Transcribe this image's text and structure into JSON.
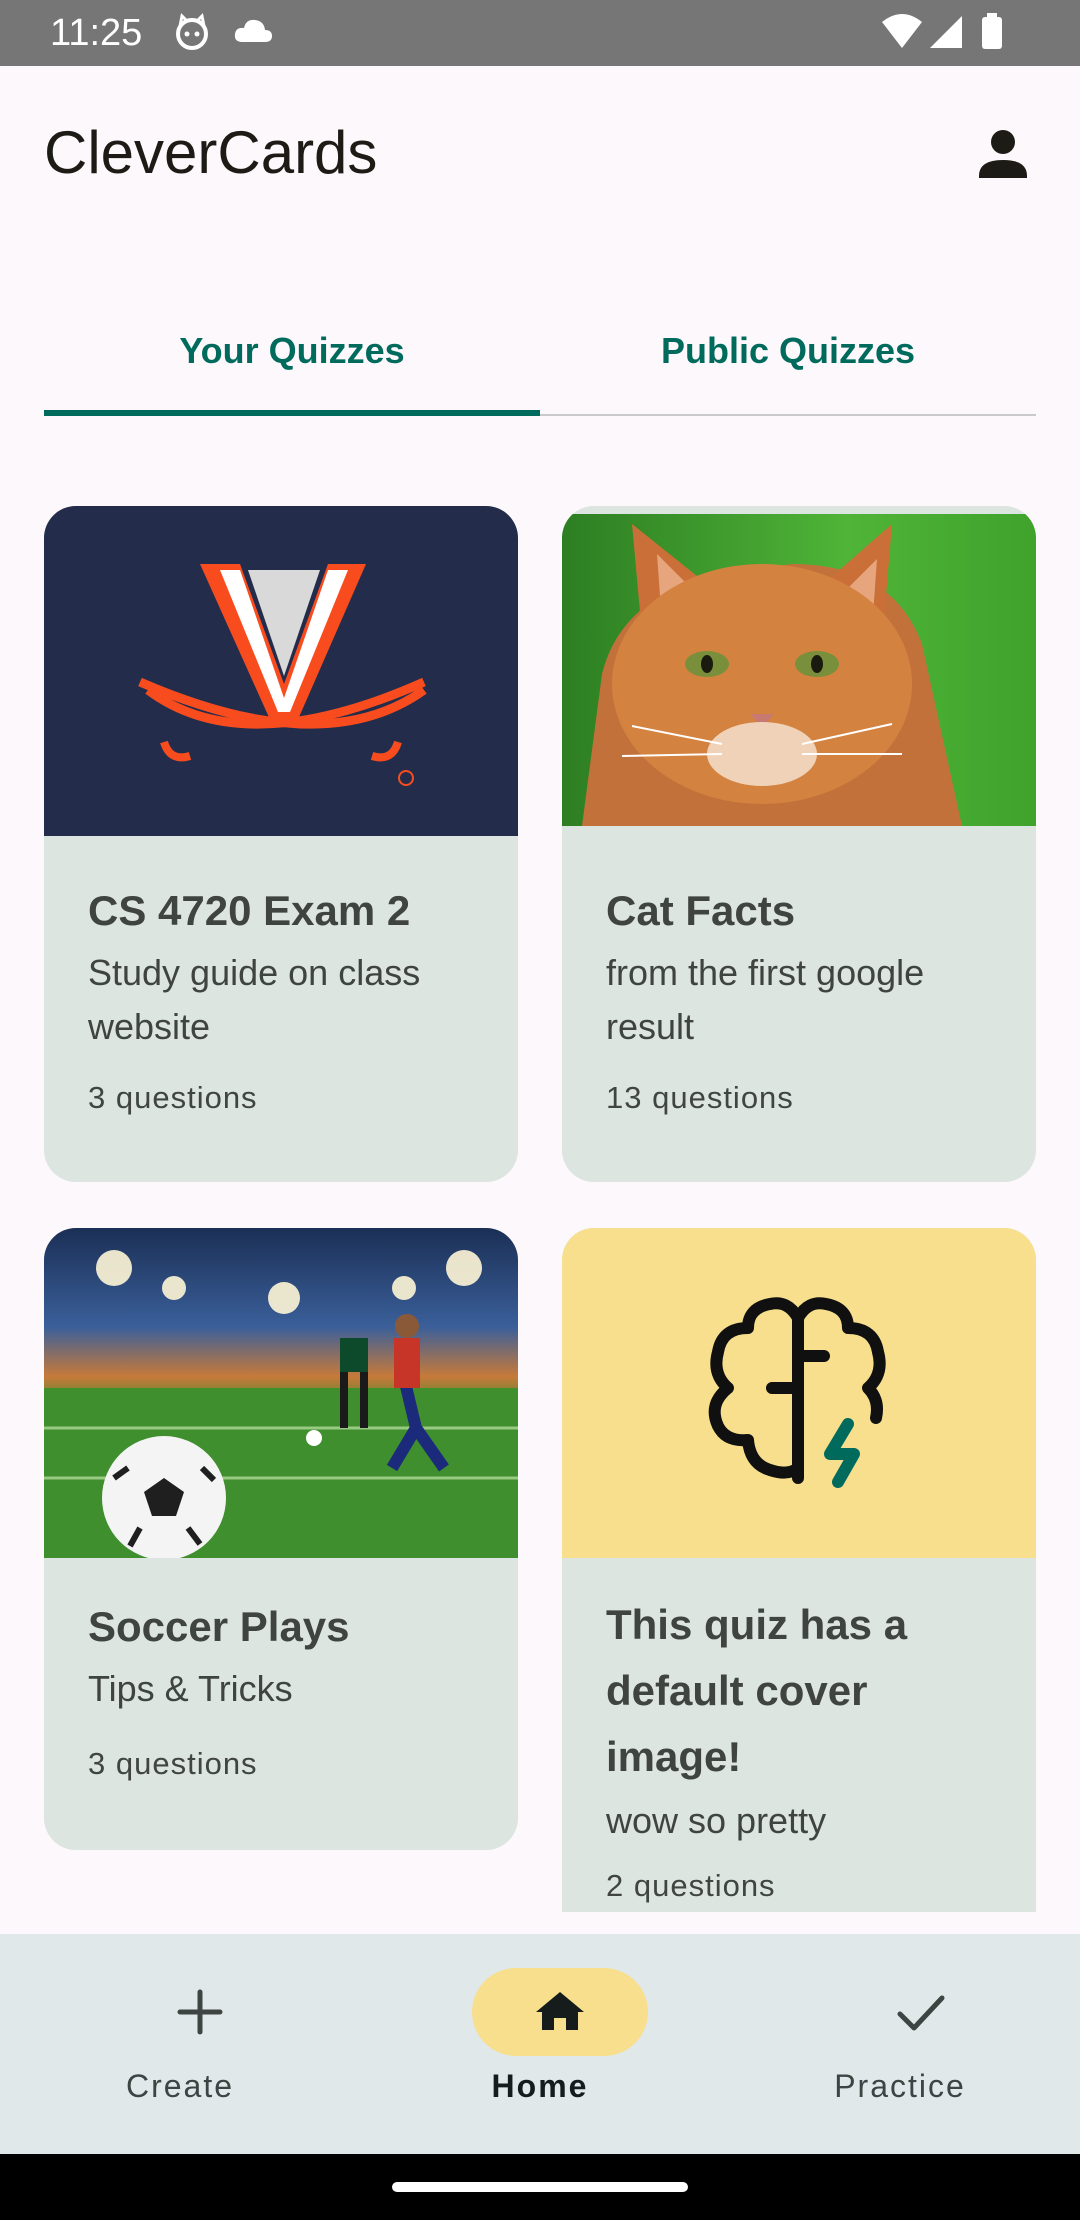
{
  "status_bar": {
    "time": "11:25",
    "icons": [
      "cat-notification-icon",
      "cloud-icon",
      "wifi-icon",
      "signal-icon",
      "battery-icon"
    ]
  },
  "app_bar": {
    "title": "CleverCards",
    "profile_icon": "person-icon"
  },
  "tabs": [
    {
      "label": "Your Quizzes",
      "selected": true
    },
    {
      "label": "Public Quizzes",
      "selected": false
    }
  ],
  "quizzes": [
    {
      "title": "CS 4720 Exam 2",
      "description": "Study guide on class website",
      "count": "3 questions",
      "cover": "uva-v-sabres-logo"
    },
    {
      "title": "Cat Facts",
      "description": "from the first google result",
      "count": "13 questions",
      "cover": "orange-cat-photo"
    },
    {
      "title": "Soccer Plays",
      "description": "Tips & Tricks",
      "count": "3 questions",
      "cover": "soccer-stadium-illustration"
    },
    {
      "title": "This quiz has a default cover image!",
      "description": "wow so pretty",
      "count": "2 questions",
      "cover": "brain-lightning-icon"
    }
  ],
  "bottom_nav": [
    {
      "label": "Create",
      "icon": "plus-icon",
      "active": false
    },
    {
      "label": "Home",
      "icon": "home-icon",
      "active": true
    },
    {
      "label": "Practice",
      "icon": "check-icon",
      "active": false
    }
  ],
  "colors": {
    "accent": "#006b5c",
    "card_bg": "#dde5e0",
    "nav_active_pill": "#f7df8e",
    "uva_navy": "#232d4b",
    "uva_orange": "#f84c1e"
  }
}
